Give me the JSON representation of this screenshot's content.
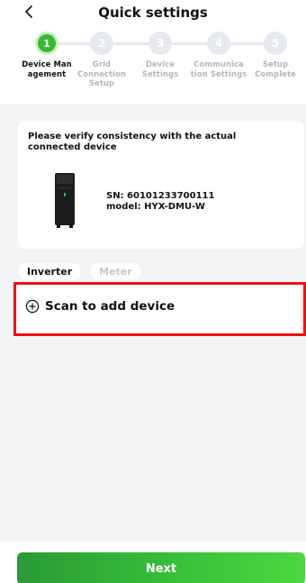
{
  "header": {
    "title": "Quick settings",
    "back_icon": "chevron-left-icon"
  },
  "steps": [
    {
      "number": "1",
      "label": "Device Man agement",
      "state": "active"
    },
    {
      "number": "2",
      "label": "Grid Connection Setup",
      "state": "pending"
    },
    {
      "number": "3",
      "label": "Device Settings",
      "state": "pending"
    },
    {
      "number": "4",
      "label": "Communica tion Settings",
      "state": "pending"
    },
    {
      "number": "5",
      "label": "Setup Complete",
      "state": "pending"
    }
  ],
  "device_card": {
    "message": "Please verify consistency with the actual connected device",
    "sn": "SN: 60101233700111",
    "model": "model: HYX-DMU-W"
  },
  "tabs": [
    {
      "label": "Inverter",
      "active": true
    },
    {
      "label": "Meter",
      "active": false
    }
  ],
  "scan": {
    "label": "Scan to add device",
    "icon": "plus-circle-icon"
  },
  "footer": {
    "next_label": "Next"
  },
  "colors": {
    "accent": "#39b836",
    "highlight": "#ee1111",
    "background": "#f3f4f6"
  }
}
